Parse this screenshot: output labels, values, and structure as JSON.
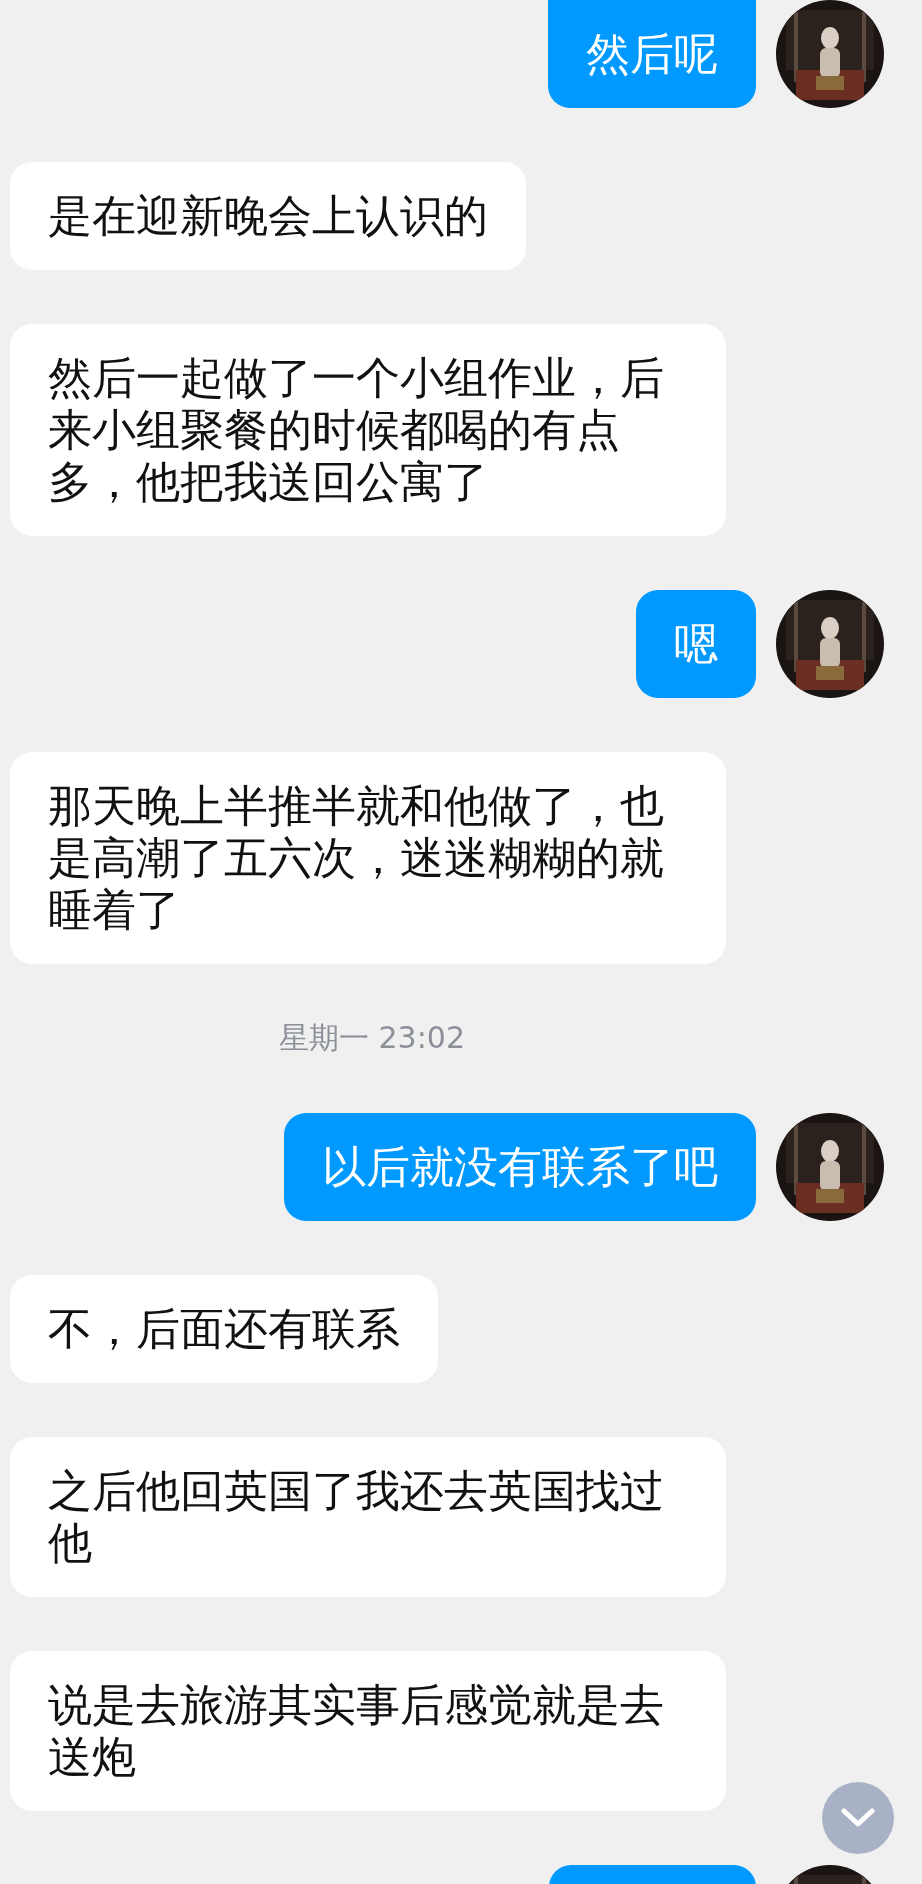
{
  "messages": [
    {
      "kind": "outgoing",
      "text": "然后呢"
    },
    {
      "kind": "incoming",
      "text": "是在迎新晚会上认识的"
    },
    {
      "kind": "incoming",
      "text": "然后一起做了一个小组作业，后来小组聚餐的时候都喝的有点多，他把我送回公寓了"
    },
    {
      "kind": "outgoing",
      "text": "嗯"
    },
    {
      "kind": "incoming",
      "text": "那天晚上半推半就和他做了，也是高潮了五六次，迷迷糊糊的就睡着了"
    },
    {
      "kind": "time",
      "text": "星期一 23:02"
    },
    {
      "kind": "outgoing",
      "text": "以后就没有联系了吧"
    },
    {
      "kind": "incoming",
      "text": "不，后面还有联系"
    },
    {
      "kind": "incoming",
      "text": "之后他回英国了我还去英国找过他"
    },
    {
      "kind": "incoming",
      "text": "说是去旅游其实事后感觉就是去送炮"
    },
    {
      "kind": "outgoing_cut"
    }
  ]
}
